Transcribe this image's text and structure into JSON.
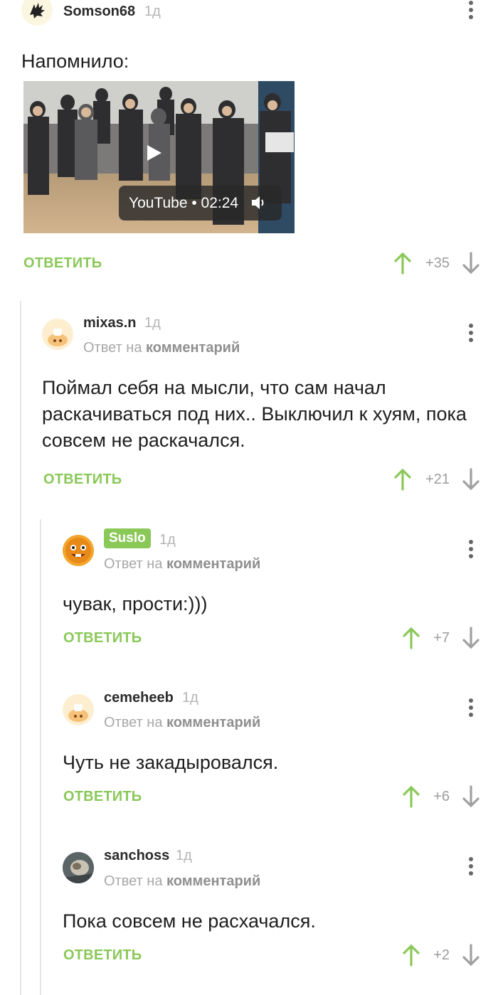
{
  "colors": {
    "accent": "#8ac858",
    "upvote": "#8ac858",
    "downvote": "#a0a0a0"
  },
  "comments": [
    {
      "username": "Somson68",
      "time": "1д",
      "text": "Напомнило:",
      "video": {
        "label": "YouTube • 02:24"
      },
      "reply_label": "ОТВЕТИТЬ",
      "score": "+35"
    },
    {
      "username": "mixas.n",
      "time": "1д",
      "reply_prefix": "Ответ на",
      "reply_target": "комментарий",
      "text": "Поймал себя на мысли, что сам начал раскачиваться под них.. Выключил к хуям, пока совсем не раскачался.",
      "reply_label": "ОТВЕТИТЬ",
      "score": "+21"
    },
    {
      "username": "Suslo",
      "time": "1д",
      "reply_prefix": "Ответ на",
      "reply_target": "комментарий",
      "text": "чувак, прости:)))",
      "reply_label": "ОТВЕТИТЬ",
      "score": "+7"
    },
    {
      "username": "cemeheeb",
      "time": "1д",
      "reply_prefix": "Ответ на",
      "reply_target": "комментарий",
      "text": "Чуть не закадыровался.",
      "reply_label": "ОТВЕТИТЬ",
      "score": "+6"
    },
    {
      "username": "sanchoss",
      "time": "1д",
      "reply_prefix": "Ответ на",
      "reply_target": "комментарий",
      "text": "Пока совсем не расхачался.",
      "reply_label": "ОТВЕТИТЬ",
      "score": "+2"
    }
  ]
}
